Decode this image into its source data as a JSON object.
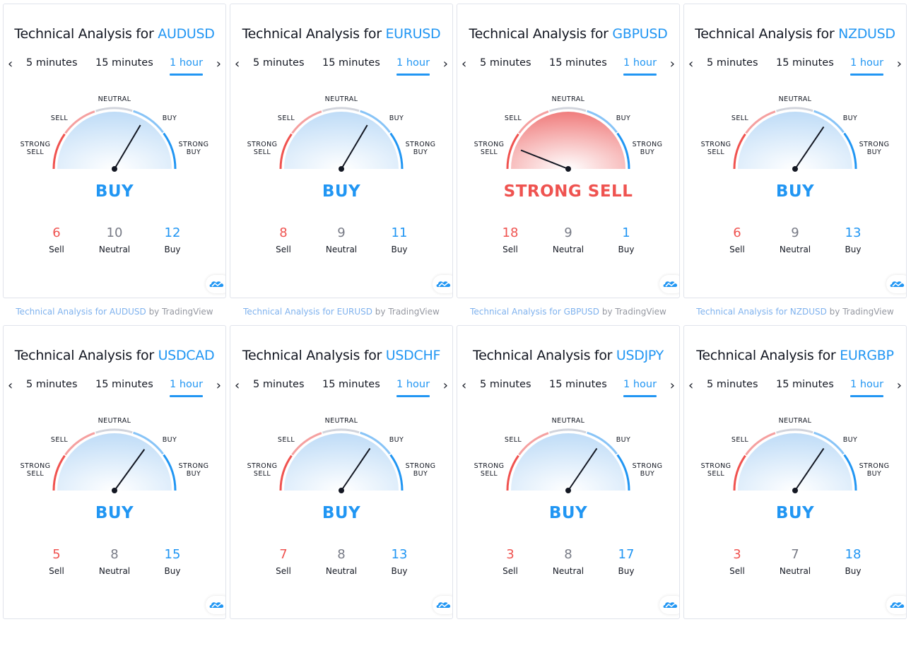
{
  "colors": {
    "accent": "#2196f3",
    "sell": "#f23645",
    "sell_text": "#ef5350",
    "neutral_text": "#787b86",
    "buy_text": "#2196f3",
    "arc_strong_sell": "#f05350",
    "arc_sell": "#f5a0a0",
    "arc_neutral": "#d1d4dc",
    "arc_buy": "#88c4f7",
    "arc_strong_buy": "#2196f3"
  },
  "common": {
    "title_prefix": "Technical Analysis for ",
    "tabs": [
      "5 minutes",
      "15 minutes",
      "1 hour"
    ],
    "active_tab": "1 hour",
    "prev_arrow": "‹",
    "next_arrow": "›",
    "gauge_labels": {
      "strong_sell": "STRONG\nSELL",
      "sell": "SELL",
      "neutral": "NEUTRAL",
      "buy": "BUY",
      "strong_buy": "STRONG\nBUY"
    },
    "count_labels": {
      "sell": "Sell",
      "neutral": "Neutral",
      "buy": "Buy"
    },
    "footer_by": " by TradingView",
    "logo_icon": "tradingview-cloud-icon"
  },
  "widgets": [
    {
      "symbol": "AUDUSD",
      "verdict": "BUY",
      "verdict_type": "buy",
      "needle": 0.67,
      "sell": "6",
      "neutral": "10",
      "buy": "12",
      "footer_link": "Technical Analysis for AUDUSD"
    },
    {
      "symbol": "EURUSD",
      "verdict": "BUY",
      "verdict_type": "buy",
      "needle": 0.67,
      "sell": "8",
      "neutral": "9",
      "buy": "11",
      "footer_link": "Technical Analysis for EURUSD"
    },
    {
      "symbol": "GBPUSD",
      "verdict": "STRONG SELL",
      "verdict_type": "strong_sell",
      "needle": 0.12,
      "sell": "18",
      "neutral": "9",
      "buy": "1",
      "footer_link": "Technical Analysis for GBPUSD"
    },
    {
      "symbol": "NZDUSD",
      "verdict": "BUY",
      "verdict_type": "buy",
      "needle": 0.69,
      "sell": "6",
      "neutral": "9",
      "buy": "13",
      "footer_link": "Technical Analysis for NZDUSD"
    },
    {
      "symbol": "USDCAD",
      "verdict": "BUY",
      "verdict_type": "buy",
      "needle": 0.7,
      "sell": "5",
      "neutral": "8",
      "buy": "15"
    },
    {
      "symbol": "USDCHF",
      "verdict": "BUY",
      "verdict_type": "buy",
      "needle": 0.69,
      "sell": "7",
      "neutral": "8",
      "buy": "13"
    },
    {
      "symbol": "USDJPY",
      "verdict": "BUY",
      "verdict_type": "buy",
      "needle": 0.69,
      "sell": "3",
      "neutral": "8",
      "buy": "17"
    },
    {
      "symbol": "EURGBP",
      "verdict": "BUY",
      "verdict_type": "buy",
      "needle": 0.69,
      "sell": "3",
      "neutral": "7",
      "buy": "18"
    }
  ]
}
